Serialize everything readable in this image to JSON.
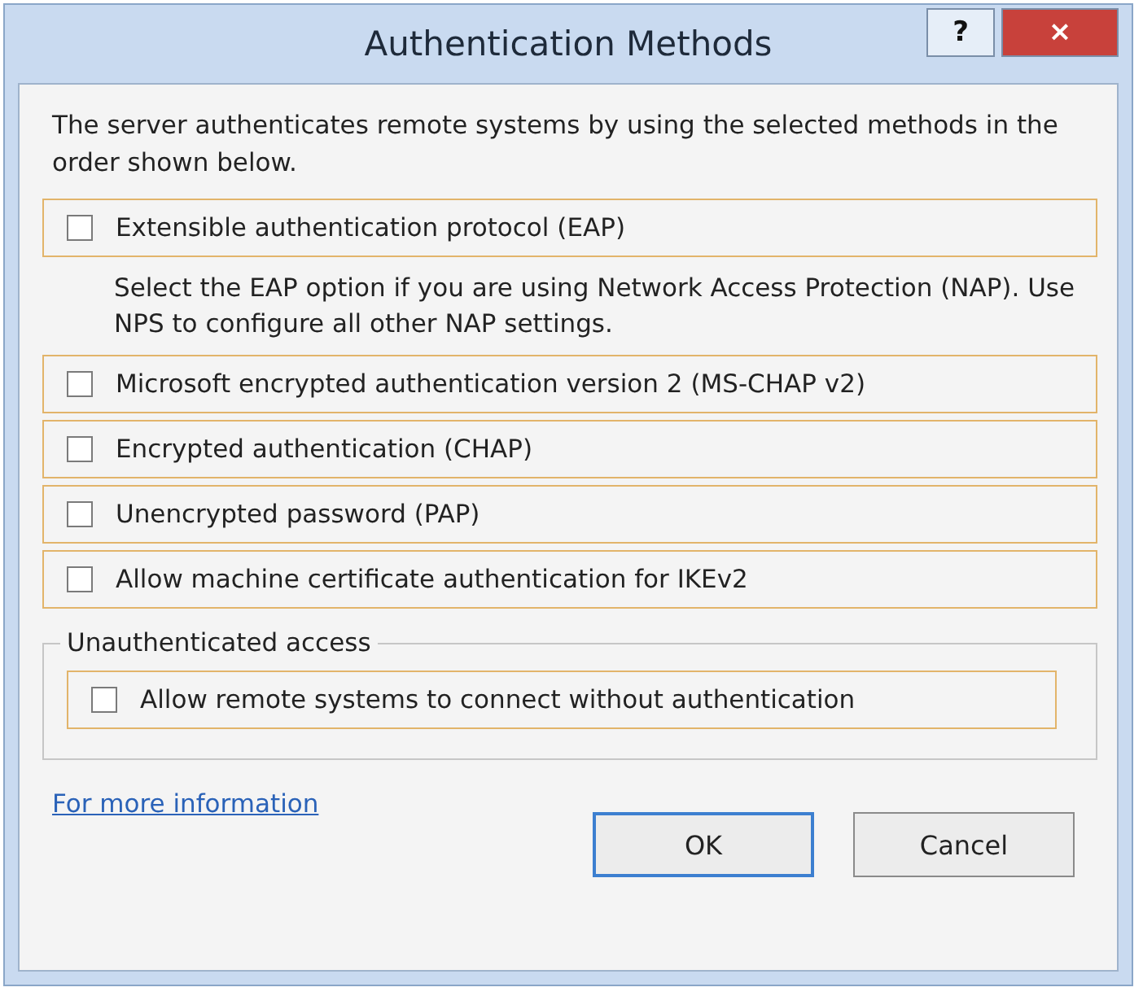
{
  "window": {
    "title": "Authentication Methods",
    "help_button": "?",
    "close_button": "×"
  },
  "intro": "The server authenticates remote systems by using the selected methods in the order shown below.",
  "methods": [
    {
      "kind": "check",
      "label": "Extensible authentication protocol (EAP)",
      "checked": false
    },
    {
      "kind": "note",
      "text": "Select the EAP option if you are using Network Access Protection (NAP). Use NPS to configure all other NAP settings."
    },
    {
      "kind": "check",
      "label": "Microsoft encrypted authentication version 2 (MS-CHAP v2)",
      "checked": false
    },
    {
      "kind": "check",
      "label": "Encrypted authentication (CHAP)",
      "checked": false
    },
    {
      "kind": "check",
      "label": "Unencrypted password (PAP)",
      "checked": false
    },
    {
      "kind": "check",
      "label": "Allow machine certificate authentication for IKEv2",
      "checked": false
    }
  ],
  "unauthenticated": {
    "title": "Unauthenticated access",
    "label": "Allow remote systems to connect without authentication",
    "checked": false
  },
  "link": "For more information",
  "buttons": [
    "OK",
    "Cancel"
  ]
}
